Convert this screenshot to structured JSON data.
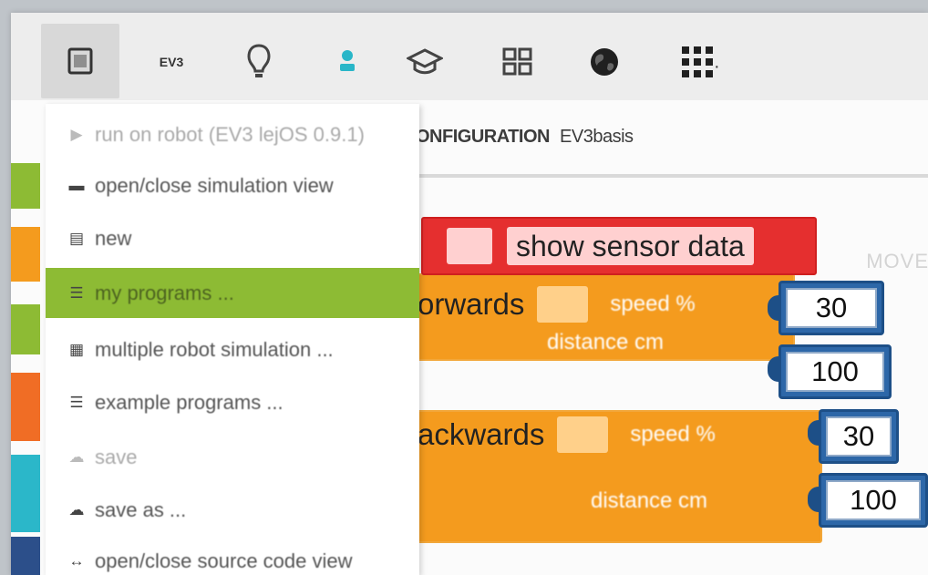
{
  "toolbar": {
    "items": [
      {
        "name": "program-icon",
        "label": ""
      },
      {
        "name": "ev3-robot",
        "label": "EV3"
      },
      {
        "name": "lightbulb-icon",
        "label": ""
      },
      {
        "name": "user-icon",
        "label": ""
      },
      {
        "name": "graduation-cap-icon",
        "label": ""
      },
      {
        "name": "grid-icon",
        "label": ""
      },
      {
        "name": "language-globe-icon",
        "label": ""
      },
      {
        "name": "apps-icon",
        "label": ""
      }
    ],
    "accent_user": "#29b6c8"
  },
  "menu": {
    "items": [
      {
        "label": "run on robot (EV3 lejOS 0.9.1)",
        "icon": "play-icon",
        "state": "disabled"
      },
      {
        "label": "open/close simulation view",
        "icon": "simulation-icon",
        "state": "normal"
      },
      {
        "label": "new",
        "icon": "new-icon",
        "state": "normal"
      },
      {
        "label": "my programs ...",
        "icon": "list-icon",
        "state": "active"
      },
      {
        "label": "multiple robot simulation ...",
        "icon": "multiple-robot-icon",
        "state": "normal"
      },
      {
        "label": "example programs ...",
        "icon": "list-icon",
        "state": "normal"
      },
      {
        "label": "save",
        "icon": "save-icon",
        "state": "disabled"
      },
      {
        "label": "save as ...",
        "icon": "save-as-icon",
        "state": "normal"
      },
      {
        "label": "open/close source code view",
        "icon": "code-icon",
        "state": "normal"
      }
    ],
    "active_color": "#8dbb34"
  },
  "workspace": {
    "configuration_label": "ONFIGURATION",
    "configuration_value": "EV3basis",
    "ghost_text": "MOVE",
    "blocks": [
      {
        "title": "show sensor data",
        "color": "#e52f2f"
      },
      {
        "title": "orwards",
        "field_label": "speed %",
        "value": "30",
        "color": "#f49b1e"
      },
      {
        "title": "",
        "field_label": "distance cm",
        "value": "100",
        "color": "#f49b1e"
      },
      {
        "title": "ackwards",
        "field_label": "speed %",
        "value": "30",
        "color": "#f49b1e"
      },
      {
        "title": "",
        "field_label": "distance cm",
        "value": "100",
        "color": "#f49b1e"
      }
    ]
  },
  "sidebar_strip": {
    "colors": [
      "#8dbb34",
      "#f49b1e",
      "#8dbb34",
      "#f06d25",
      "#2bb7c9",
      "#2c4f8a"
    ]
  }
}
